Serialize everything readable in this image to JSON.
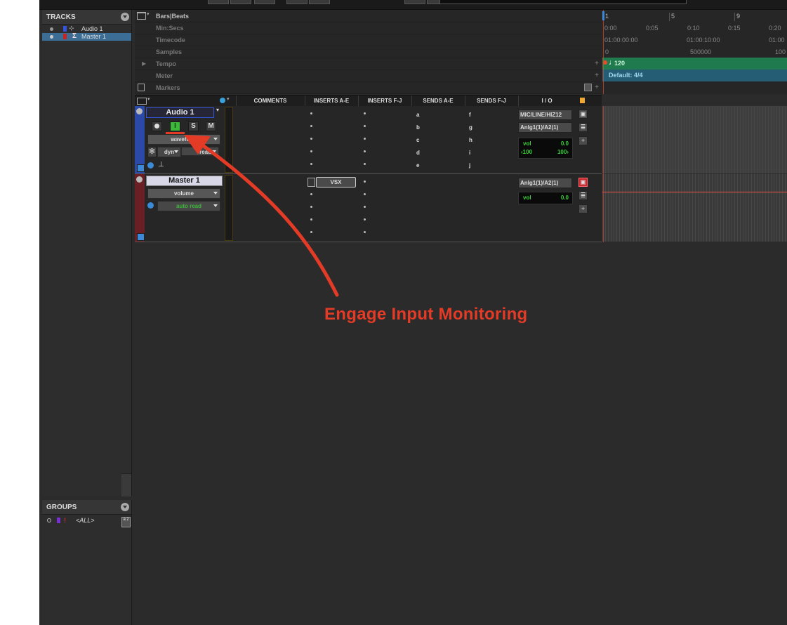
{
  "tracks_panel": {
    "title": "TRACKS",
    "items": [
      {
        "name": "Audio 1",
        "color": "#3355dd"
      },
      {
        "name": "Master 1",
        "color": "#cc2222"
      }
    ]
  },
  "groups_panel": {
    "title": "GROUPS",
    "items": [
      {
        "flag": "!",
        "name": "<ALL>",
        "color": "#7a2fd0"
      }
    ],
    "sort_glyph": "a z"
  },
  "rulers": [
    {
      "label": "Bars|Beats",
      "active": true
    },
    {
      "label": "Min:Secs"
    },
    {
      "label": "Timecode"
    },
    {
      "label": "Samples"
    },
    {
      "label": "Tempo"
    },
    {
      "label": "Meter"
    },
    {
      "label": "Markers"
    }
  ],
  "timeline": {
    "bars": [
      "1",
      "5",
      "9"
    ],
    "minsecs": [
      "0:00",
      "0:05",
      "0:10",
      "0:15",
      "0:20"
    ],
    "timecode": [
      "01:00:00:00",
      "01:00:10:00",
      "01:00"
    ],
    "samples": [
      "0",
      "500000",
      "100"
    ],
    "tempo": "120",
    "meter": "Default: 4/4"
  },
  "columns": [
    "COMMENTS",
    "INSERTS A-E",
    "INSERTS F-J",
    "SENDS A-E",
    "SENDS F-J",
    "I / O"
  ],
  "audio_track": {
    "name": "Audio 1",
    "rec": "●",
    "input": "I",
    "solo": "S",
    "mute": "M",
    "view": "waveform",
    "dyn": "dyn",
    "automation": "read",
    "sends_ae": [
      "a",
      "b",
      "c",
      "d",
      "e"
    ],
    "sends_fj": [
      "f",
      "g",
      "h",
      "i",
      "j"
    ],
    "io_input": "MIC/LINE/HIZ12",
    "io_output": "Anlg1(1)/A2(1)",
    "vol_label": "vol",
    "vol_value": "0.0",
    "pan_left": "‹100",
    "pan_right": "100›"
  },
  "master_track": {
    "name": "Master 1",
    "view": "volume",
    "automation": "auto read",
    "insert_a": "VSX",
    "io_output": "Anlg1(1)/A2(1)",
    "vol_label": "vol",
    "vol_value": "0.0"
  },
  "annotation": {
    "text": "Engage Input Monitoring",
    "color": "#e33b26"
  }
}
